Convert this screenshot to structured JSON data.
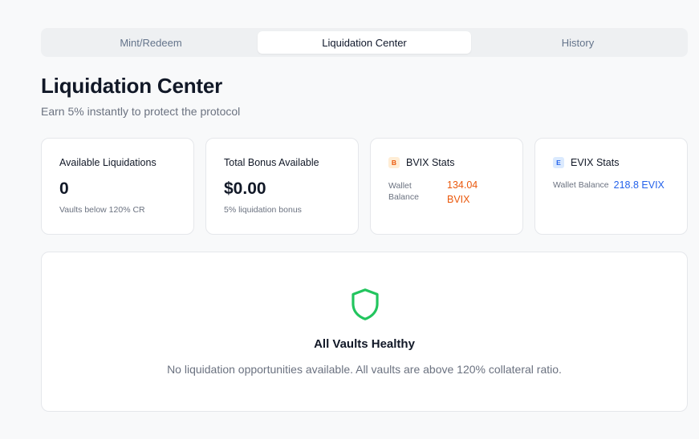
{
  "tabs": [
    {
      "label": "Mint/Redeem",
      "active": false
    },
    {
      "label": "Liquidation Center",
      "active": true
    },
    {
      "label": "History",
      "active": false
    }
  ],
  "header": {
    "title": "Liquidation Center",
    "subtitle": "Earn 5% instantly to protect the protocol"
  },
  "cards": {
    "available": {
      "title": "Available Liquidations",
      "value": "0",
      "note": "Vaults below 120% CR"
    },
    "bonus": {
      "title": "Total Bonus Available",
      "value": "$0.00",
      "note": "5% liquidation bonus"
    },
    "bvix": {
      "badge": "B",
      "title": "BVIX Stats",
      "label_line1": "Wallet",
      "label_line2": "Balance",
      "value_line1": "134.04",
      "value_line2": "BVIX",
      "color": "#ea580c"
    },
    "evix": {
      "badge": "E",
      "title": "EVIX Stats",
      "label": "Wallet Balance",
      "value": "218.8 EVIX",
      "color": "#2563eb"
    }
  },
  "healthy": {
    "icon": "shield-icon",
    "title": "All Vaults Healthy",
    "description": "No liquidation opportunities available. All vaults are above 120% collateral ratio.",
    "color": "#22c55e"
  }
}
